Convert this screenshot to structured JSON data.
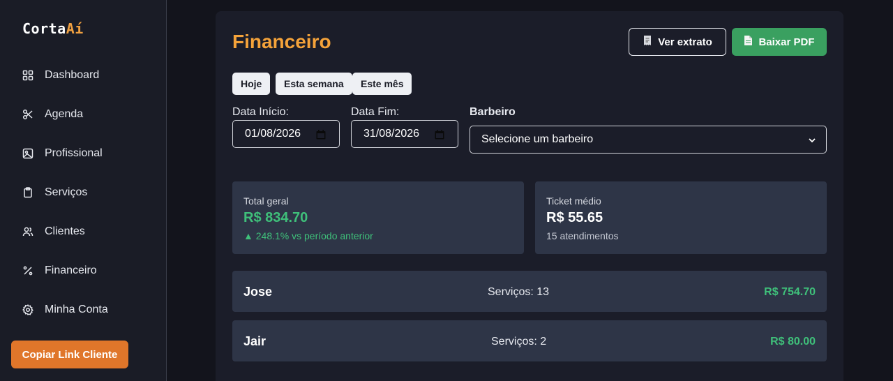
{
  "brand": {
    "name_main": "Corta",
    "name_accent": "Aí",
    "accent_color": "#f0a040"
  },
  "sidebar": {
    "items": [
      {
        "label": "Dashboard",
        "icon": "grid-icon"
      },
      {
        "label": "Agenda",
        "icon": "scissors-icon"
      },
      {
        "label": "Profissional",
        "icon": "image-icon"
      },
      {
        "label": "Serviços",
        "icon": "clipboard-icon"
      },
      {
        "label": "Clientes",
        "icon": "users-icon"
      },
      {
        "label": "Financeiro",
        "icon": "percent-icon"
      },
      {
        "label": "Minha Conta",
        "icon": "gear-icon"
      }
    ],
    "copy_link_label": "Copiar Link Cliente"
  },
  "page": {
    "title": "Financeiro",
    "extrato_label": "Ver extrato",
    "pdf_label": "Baixar PDF"
  },
  "filters": {
    "chips": [
      "Hoje",
      "Esta semana",
      "Este mês"
    ],
    "start_label": "Data Início:",
    "start_value": "01/08/2026",
    "end_label": "Data Fim:",
    "end_value": "31/08/2026",
    "barber_label": "Barbeiro",
    "barber_value": "Selecione um barbeiro"
  },
  "stats": {
    "total": {
      "label": "Total geral",
      "value": "R$ 834.70",
      "change": "▲ 248.1% vs período anterior"
    },
    "ticket": {
      "label": "Ticket médio",
      "value": "R$ 55.65",
      "sub": "15 atendimentos"
    }
  },
  "barbers": [
    {
      "name": "Jose",
      "services": "Serviços: 13",
      "total": "R$ 754.70"
    },
    {
      "name": "Jair",
      "services": "Serviços: 2",
      "total": "R$ 80.00"
    }
  ],
  "colors": {
    "accent_orange": "#f5a33a",
    "success_green": "#3fc07a",
    "pdf_button": "#3aa060",
    "copy_button": "#e0762a"
  }
}
